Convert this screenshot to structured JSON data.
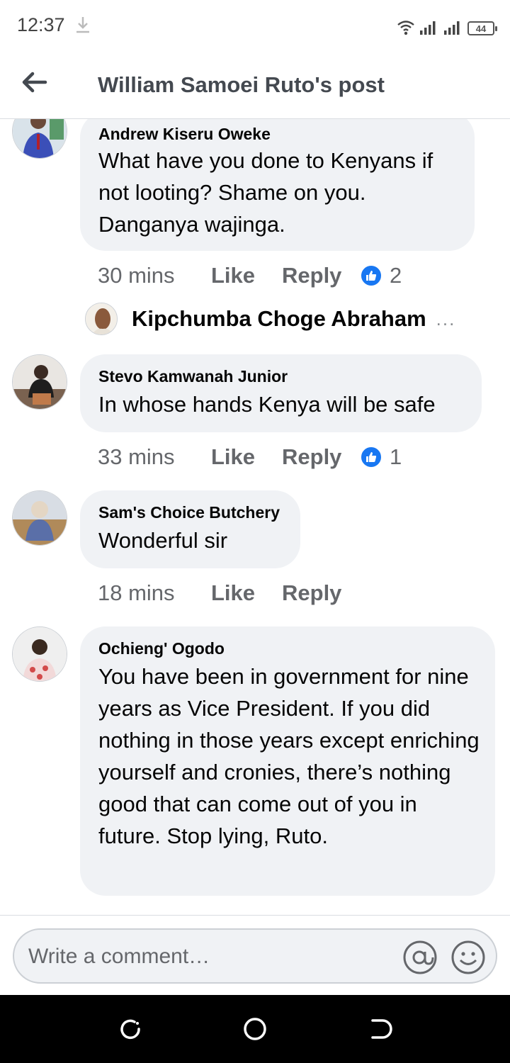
{
  "status_bar": {
    "time": "12:37",
    "battery": "44",
    "icons": [
      "download-icon",
      "wifi-icon",
      "signal-icon",
      "signal-icon",
      "battery-icon"
    ]
  },
  "header": {
    "title": "William Samoei Ruto's post",
    "back_icon": "back-arrow-icon"
  },
  "comments": [
    {
      "author": "Andrew Kiseru Oweke",
      "text": "What have you done to Kenyans if not looting? Shame on you. Danganya wajinga.",
      "time": "30 mins",
      "like_label": "Like",
      "reply_label": "Reply",
      "reaction_count": "2"
    },
    {
      "author": "Stevo Kamwanah Junior",
      "text": "In whose hands Kenya will be safe",
      "time": "33 mins",
      "like_label": "Like",
      "reply_label": "Reply",
      "reaction_count": "1"
    },
    {
      "author": "Sam's Choice Butchery",
      "text": "Wonderful sir",
      "time": "18 mins",
      "like_label": "Like",
      "reply_label": "Reply"
    },
    {
      "author": "Ochieng' Ogodo",
      "text": "You have been in government for nine years as Vice President. If you did nothing in those years except enriching yourself and cronies, there’s nothing good that can come out of you in future. Stop lying, Ruto."
    }
  ],
  "reply_preview": {
    "name": "Kipchumba Choge Abraham",
    "more": "..."
  },
  "composer": {
    "placeholder": "Write a comment…",
    "icons": [
      "at-mention-icon",
      "emoji-icon"
    ]
  },
  "nav": {
    "icons": [
      "recents-icon",
      "home-icon",
      "back-icon"
    ]
  },
  "colors": {
    "bubble": "#f0f2f5",
    "meta_text": "#65676b",
    "like_blue": "#1877f2"
  }
}
